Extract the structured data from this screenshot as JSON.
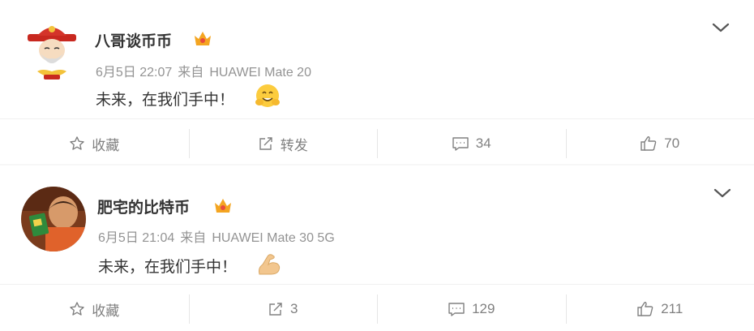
{
  "posts": [
    {
      "author": "八哥谈币币",
      "date": "6月5日 22:07",
      "source_prefix": "来自",
      "device": "HUAWEI Mate 20",
      "text": "未来，在我们手中！",
      "emoji_icon": "hugging-face-icon",
      "actions": {
        "favorite": "收藏",
        "repost": "转发",
        "comments": "34",
        "likes": "70"
      }
    },
    {
      "author": "肥宅的比特币",
      "date": "6月5日 21:04",
      "source_prefix": "来自",
      "device": "HUAWEI Mate 30 5G",
      "text": "未来，在我们手中！",
      "emoji_icon": "flexed-biceps-icon",
      "actions": {
        "favorite": "收藏",
        "repost": "3",
        "comments": "129",
        "likes": "211"
      }
    }
  ],
  "colors": {
    "text": "#333333",
    "meta": "#939393",
    "badge": "#f4a521"
  }
}
